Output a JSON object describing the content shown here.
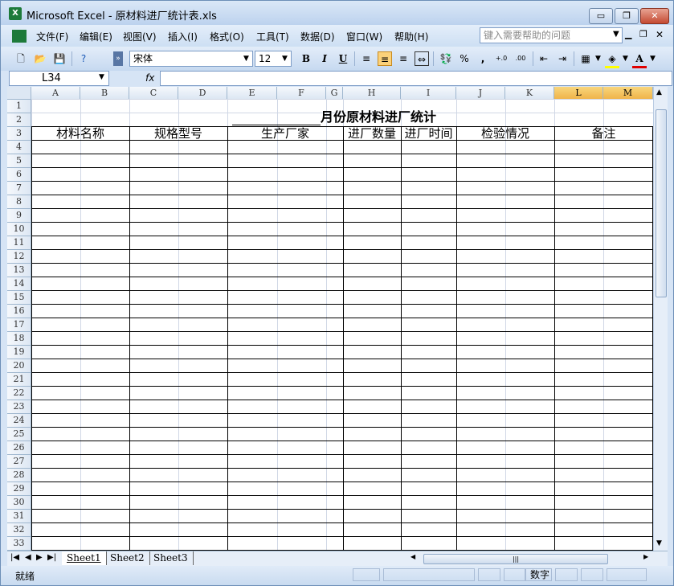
{
  "window": {
    "title": "Microsoft Excel - 原材料进厂统计表.xls",
    "minimize_glyph": "▭",
    "restore_glyph": "❐",
    "close_glyph": "✕"
  },
  "menu": {
    "items": [
      "文件(F)",
      "编辑(E)",
      "视图(V)",
      "插入(I)",
      "格式(O)",
      "工具(T)",
      "数据(D)",
      "窗口(W)",
      "帮助(H)"
    ],
    "help_placeholder": "键入需要帮助的问题"
  },
  "toolbar": {
    "font_name": "宋体",
    "font_size": "12",
    "bold": "B",
    "italic": "I",
    "underline": "U",
    "percent": "%",
    "comma": ",",
    "increase_decimal": "+.0",
    "decrease_decimal": ".00",
    "active_button": "align-center"
  },
  "formula_bar": {
    "name_box": "L34",
    "fx": "fx",
    "formula": ""
  },
  "grid": {
    "columns": [
      "A",
      "B",
      "C",
      "D",
      "E",
      "F",
      "G",
      "H",
      "I",
      "J",
      "K",
      "L",
      "M"
    ],
    "selected_columns": [
      "L",
      "M"
    ],
    "rows": [
      "1",
      "2",
      "3",
      "4",
      "5",
      "6",
      "7",
      "8",
      "9",
      "10",
      "11",
      "12",
      "13",
      "14",
      "15",
      "16",
      "17",
      "18",
      "19",
      "20",
      "21",
      "22",
      "23",
      "24",
      "25",
      "26",
      "27",
      "28",
      "29",
      "30",
      "31",
      "32",
      "33"
    ],
    "title_suffix": "月份原材料进厂统计",
    "headers": [
      "材料名称",
      "规格型号",
      "生产厂家",
      "进厂数量",
      "进厂时间",
      "检验情况",
      "备注"
    ]
  },
  "sheets": {
    "tabs": [
      "Sheet1",
      "Sheet2",
      "Sheet3"
    ],
    "active": "Sheet1",
    "nav": [
      "|◀",
      "◀",
      "▶",
      "▶|"
    ]
  },
  "status": {
    "ready": "就绪",
    "mode": "数字"
  },
  "colors": {
    "titlebar": "#bcd2ee",
    "selected_header": "#f0b44a",
    "close_button": "#c44a32"
  }
}
